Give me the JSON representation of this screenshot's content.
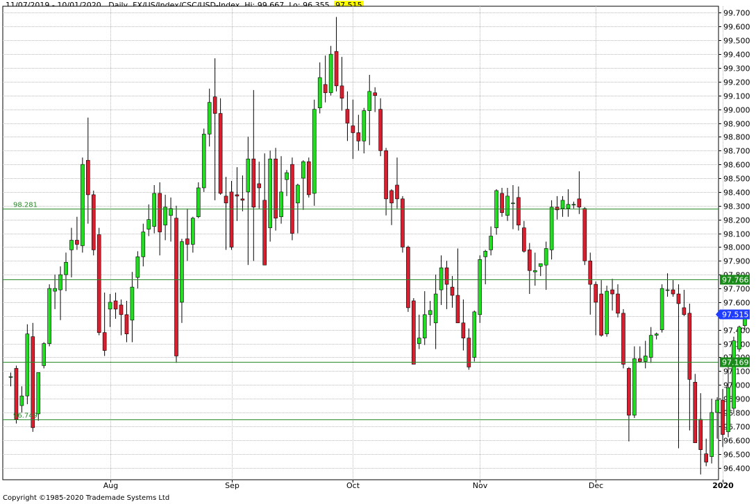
{
  "header": {
    "date_range": "11/07/2019 - 10/01/2020",
    "interval": "Daily",
    "symbol": "FX/US/Index/CSC/USD-Index",
    "hi": "Hi: 99.667",
    "lo": "Lo: 96.355",
    "last": "97.515"
  },
  "footer": {
    "copyright": "Copyright ©1985-2020 Trademade Systems Ltd"
  },
  "colors": {
    "up": "#22dd22",
    "down": "#d81f2f",
    "hline": "#2a8a2a",
    "grid": "#b8b8b8",
    "last_marker": "#1f3cff",
    "level_marker": "#1a8a1a"
  },
  "chart_data": {
    "type": "candlestick",
    "ylim": [
      96.35,
      99.75
    ],
    "y_ticks": [
      "96.400",
      "96.500",
      "96.600",
      "96.700",
      "96.800",
      "96.900",
      "97.000",
      "97.100",
      "97.200",
      "97.300",
      "97.400",
      "97.500",
      "97.600",
      "97.700",
      "97.800",
      "97.900",
      "98.000",
      "98.100",
      "98.200",
      "98.300",
      "98.400",
      "98.500",
      "98.600",
      "98.700",
      "98.800",
      "98.900",
      "99.000",
      "99.100",
      "99.200",
      "99.300",
      "99.400",
      "99.500",
      "99.600",
      "99.700"
    ],
    "x_labels": [
      {
        "label": "Aug",
        "index": 18,
        "bold": false
      },
      {
        "label": "Sep",
        "index": 40,
        "bold": false
      },
      {
        "label": "Oct",
        "index": 62,
        "bold": false
      },
      {
        "label": "Nov",
        "index": 85,
        "bold": false
      },
      {
        "label": "Dec",
        "index": 106,
        "bold": false
      },
      {
        "label": "2020",
        "index": 129,
        "bold": true
      }
    ],
    "horizontal_lines": [
      {
        "value": 98.281,
        "label": "98.281",
        "label_side": "left"
      },
      {
        "value": 97.766,
        "label": "97.766",
        "label_side": "right"
      },
      {
        "value": 97.169,
        "label": "97.169",
        "label_side": "right"
      },
      {
        "value": 96.749,
        "label": "96.749",
        "label_side": "left"
      }
    ],
    "last_value": {
      "value": 97.515,
      "label": "97.515"
    },
    "candles": [
      {
        "o": 97.06,
        "h": 97.09,
        "l": 96.99,
        "c": 97.06
      },
      {
        "o": 97.12,
        "h": 97.14,
        "l": 96.72,
        "c": 96.75
      },
      {
        "o": 96.85,
        "h": 96.99,
        "l": 96.8,
        "c": 96.92
      },
      {
        "o": 96.92,
        "h": 97.44,
        "l": 96.86,
        "c": 97.37
      },
      {
        "o": 97.35,
        "h": 97.45,
        "l": 96.66,
        "c": 96.69
      },
      {
        "o": 96.79,
        "h": 96.97,
        "l": 96.74,
        "c": 97.09
      },
      {
        "o": 97.14,
        "h": 97.31,
        "l": 97.12,
        "c": 97.3
      },
      {
        "o": 97.3,
        "h": 97.73,
        "l": 97.28,
        "c": 97.7
      },
      {
        "o": 97.68,
        "h": 97.8,
        "l": 97.55,
        "c": 97.7
      },
      {
        "o": 97.69,
        "h": 97.86,
        "l": 97.47,
        "c": 97.8
      },
      {
        "o": 97.8,
        "h": 97.96,
        "l": 97.68,
        "c": 97.89
      },
      {
        "o": 97.98,
        "h": 98.14,
        "l": 97.78,
        "c": 98.05
      },
      {
        "o": 98.05,
        "h": 98.22,
        "l": 97.98,
        "c": 98.02
      },
      {
        "o": 98.01,
        "h": 98.65,
        "l": 97.96,
        "c": 98.6
      },
      {
        "o": 98.63,
        "h": 98.94,
        "l": 98.17,
        "c": 98.38
      },
      {
        "o": 98.38,
        "h": 98.41,
        "l": 97.94,
        "c": 97.98
      },
      {
        "o": 98.09,
        "h": 98.14,
        "l": 97.36,
        "c": 97.38
      },
      {
        "o": 97.38,
        "h": 97.67,
        "l": 97.21,
        "c": 97.25
      },
      {
        "o": 97.55,
        "h": 97.66,
        "l": 97.42,
        "c": 97.6
      },
      {
        "o": 97.61,
        "h": 97.67,
        "l": 97.48,
        "c": 97.55
      },
      {
        "o": 97.58,
        "h": 97.62,
        "l": 97.36,
        "c": 97.51
      },
      {
        "o": 97.51,
        "h": 97.61,
        "l": 97.31,
        "c": 97.37
      },
      {
        "o": 97.47,
        "h": 97.82,
        "l": 97.31,
        "c": 97.71
      },
      {
        "o": 97.78,
        "h": 97.97,
        "l": 97.7,
        "c": 97.93
      },
      {
        "o": 97.93,
        "h": 98.17,
        "l": 97.86,
        "c": 98.11
      },
      {
        "o": 98.13,
        "h": 98.31,
        "l": 98.08,
        "c": 98.2
      },
      {
        "o": 98.15,
        "h": 98.45,
        "l": 98.1,
        "c": 98.39
      },
      {
        "o": 98.39,
        "h": 98.47,
        "l": 97.94,
        "c": 98.11
      },
      {
        "o": 98.16,
        "h": 98.38,
        "l": 98.05,
        "c": 98.29
      },
      {
        "o": 98.23,
        "h": 98.36,
        "l": 98.04,
        "c": 98.28
      },
      {
        "o": 98.21,
        "h": 98.3,
        "l": 97.16,
        "c": 97.21
      },
      {
        "o": 97.6,
        "h": 98.06,
        "l": 97.45,
        "c": 98.04
      },
      {
        "o": 98.06,
        "h": 98.28,
        "l": 97.9,
        "c": 98.02
      },
      {
        "o": 98.02,
        "h": 98.22,
        "l": 97.96,
        "c": 98.21
      },
      {
        "o": 98.22,
        "h": 98.47,
        "l": 98.21,
        "c": 98.43
      },
      {
        "o": 98.43,
        "h": 98.86,
        "l": 98.4,
        "c": 98.82
      },
      {
        "o": 98.82,
        "h": 99.15,
        "l": 98.73,
        "c": 99.05
      },
      {
        "o": 99.09,
        "h": 99.37,
        "l": 98.34,
        "c": 98.97
      },
      {
        "o": 98.97,
        "h": 99.08,
        "l": 98.38,
        "c": 98.39
      },
      {
        "o": 98.37,
        "h": 98.51,
        "l": 97.98,
        "c": 98.32
      },
      {
        "o": 98.4,
        "h": 98.48,
        "l": 97.98,
        "c": 98.0
      },
      {
        "o": 98.38,
        "h": 98.58,
        "l": 98.19,
        "c": 98.37
      },
      {
        "o": 98.35,
        "h": 98.52,
        "l": 98.26,
        "c": 98.34
      },
      {
        "o": 98.4,
        "h": 98.8,
        "l": 97.87,
        "c": 98.64
      },
      {
        "o": 98.64,
        "h": 99.14,
        "l": 97.9,
        "c": 98.29
      },
      {
        "o": 98.46,
        "h": 98.62,
        "l": 98.28,
        "c": 98.43
      },
      {
        "o": 98.34,
        "h": 98.68,
        "l": 97.87,
        "c": 97.87
      },
      {
        "o": 98.14,
        "h": 98.7,
        "l": 98.04,
        "c": 98.64
      },
      {
        "o": 98.64,
        "h": 98.72,
        "l": 98.12,
        "c": 98.21
      },
      {
        "o": 98.22,
        "h": 98.66,
        "l": 98.17,
        "c": 98.4
      },
      {
        "o": 98.49,
        "h": 98.56,
        "l": 98.37,
        "c": 98.54
      },
      {
        "o": 98.6,
        "h": 98.65,
        "l": 98.05,
        "c": 98.1
      },
      {
        "o": 98.32,
        "h": 98.46,
        "l": 98.1,
        "c": 98.45
      },
      {
        "o": 98.5,
        "h": 98.63,
        "l": 98.27,
        "c": 98.62
      },
      {
        "o": 98.62,
        "h": 98.65,
        "l": 98.36,
        "c": 98.38
      },
      {
        "o": 98.39,
        "h": 99.07,
        "l": 98.3,
        "c": 99.0
      },
      {
        "o": 99.01,
        "h": 99.34,
        "l": 98.97,
        "c": 99.23
      },
      {
        "o": 99.18,
        "h": 99.39,
        "l": 99.05,
        "c": 99.12
      },
      {
        "o": 99.12,
        "h": 99.46,
        "l": 99.1,
        "c": 99.4
      },
      {
        "o": 99.42,
        "h": 99.67,
        "l": 99.13,
        "c": 99.17
      },
      {
        "o": 99.17,
        "h": 99.38,
        "l": 98.99,
        "c": 99.08
      },
      {
        "o": 99.0,
        "h": 99.13,
        "l": 98.77,
        "c": 98.9
      },
      {
        "o": 98.88,
        "h": 99.07,
        "l": 98.64,
        "c": 98.83
      },
      {
        "o": 98.83,
        "h": 98.96,
        "l": 98.7,
        "c": 98.77
      },
      {
        "o": 98.77,
        "h": 99.01,
        "l": 98.68,
        "c": 98.99
      },
      {
        "o": 98.99,
        "h": 99.25,
        "l": 98.74,
        "c": 99.13
      },
      {
        "o": 99.12,
        "h": 99.16,
        "l": 98.98,
        "c": 99.1
      },
      {
        "o": 99.0,
        "h": 99.08,
        "l": 98.66,
        "c": 98.7
      },
      {
        "o": 98.7,
        "h": 98.72,
        "l": 98.23,
        "c": 98.35
      },
      {
        "o": 98.41,
        "h": 98.42,
        "l": 98.16,
        "c": 98.32
      },
      {
        "o": 98.45,
        "h": 98.65,
        "l": 98.28,
        "c": 98.35
      },
      {
        "o": 98.35,
        "h": 98.37,
        "l": 97.96,
        "c": 98.0
      },
      {
        "o": 98.0,
        "h": 98.01,
        "l": 97.53,
        "c": 97.56
      },
      {
        "o": 97.61,
        "h": 97.63,
        "l": 97.16,
        "c": 97.15
      },
      {
        "o": 97.3,
        "h": 97.51,
        "l": 97.26,
        "c": 97.34
      },
      {
        "o": 97.34,
        "h": 97.68,
        "l": 97.29,
        "c": 97.51
      },
      {
        "o": 97.51,
        "h": 97.61,
        "l": 97.43,
        "c": 97.54
      },
      {
        "o": 97.45,
        "h": 97.8,
        "l": 97.26,
        "c": 97.66
      },
      {
        "o": 97.69,
        "h": 97.94,
        "l": 97.58,
        "c": 97.85
      },
      {
        "o": 97.85,
        "h": 97.9,
        "l": 97.55,
        "c": 97.73
      },
      {
        "o": 97.71,
        "h": 97.79,
        "l": 97.56,
        "c": 97.65
      },
      {
        "o": 97.65,
        "h": 97.99,
        "l": 97.52,
        "c": 97.45
      },
      {
        "o": 97.45,
        "h": 97.62,
        "l": 97.25,
        "c": 97.34
      },
      {
        "o": 97.34,
        "h": 97.41,
        "l": 97.11,
        "c": 97.13
      },
      {
        "o": 97.2,
        "h": 97.54,
        "l": 97.17,
        "c": 97.53
      },
      {
        "o": 97.51,
        "h": 97.94,
        "l": 97.45,
        "c": 97.91
      },
      {
        "o": 97.93,
        "h": 97.98,
        "l": 97.73,
        "c": 97.97
      },
      {
        "o": 97.98,
        "h": 98.15,
        "l": 97.94,
        "c": 98.08
      },
      {
        "o": 98.14,
        "h": 98.42,
        "l": 98.09,
        "c": 98.41
      },
      {
        "o": 98.39,
        "h": 98.43,
        "l": 98.22,
        "c": 98.25
      },
      {
        "o": 98.23,
        "h": 98.43,
        "l": 98.19,
        "c": 98.37
      },
      {
        "o": 98.32,
        "h": 98.45,
        "l": 98.13,
        "c": 98.32
      },
      {
        "o": 98.36,
        "h": 98.44,
        "l": 98.12,
        "c": 98.16
      },
      {
        "o": 98.14,
        "h": 98.19,
        "l": 97.96,
        "c": 97.97
      },
      {
        "o": 97.98,
        "h": 98.03,
        "l": 97.66,
        "c": 97.83
      },
      {
        "o": 97.82,
        "h": 97.96,
        "l": 97.72,
        "c": 97.83
      },
      {
        "o": 97.86,
        "h": 97.88,
        "l": 97.79,
        "c": 97.88
      },
      {
        "o": 97.87,
        "h": 98.04,
        "l": 97.69,
        "c": 97.99
      },
      {
        "o": 97.98,
        "h": 98.34,
        "l": 97.91,
        "c": 98.29
      },
      {
        "o": 98.29,
        "h": 98.37,
        "l": 98.2,
        "c": 98.27
      },
      {
        "o": 98.28,
        "h": 98.37,
        "l": 98.22,
        "c": 98.34
      },
      {
        "o": 98.28,
        "h": 98.42,
        "l": 98.22,
        "c": 98.31
      },
      {
        "o": 98.31,
        "h": 98.33,
        "l": 98.28,
        "c": 98.31
      },
      {
        "o": 98.35,
        "h": 98.55,
        "l": 98.24,
        "c": 98.29
      },
      {
        "o": 98.28,
        "h": 98.29,
        "l": 97.87,
        "c": 97.9
      },
      {
        "o": 97.9,
        "h": 97.96,
        "l": 97.51,
        "c": 97.73
      },
      {
        "o": 97.73,
        "h": 97.75,
        "l": 97.36,
        "c": 97.6
      },
      {
        "o": 97.66,
        "h": 97.76,
        "l": 97.35,
        "c": 97.36
      },
      {
        "o": 97.37,
        "h": 97.72,
        "l": 97.35,
        "c": 97.68
      },
      {
        "o": 97.69,
        "h": 97.77,
        "l": 97.54,
        "c": 97.66
      },
      {
        "o": 97.66,
        "h": 97.73,
        "l": 97.49,
        "c": 97.52
      },
      {
        "o": 97.52,
        "h": 97.55,
        "l": 97.12,
        "c": 97.15
      },
      {
        "o": 97.12,
        "h": 97.13,
        "l": 96.59,
        "c": 96.78
      },
      {
        "o": 96.78,
        "h": 97.28,
        "l": 96.76,
        "c": 97.19
      },
      {
        "o": 97.19,
        "h": 97.28,
        "l": 97.16,
        "c": 97.17
      },
      {
        "o": 97.17,
        "h": 97.32,
        "l": 97.12,
        "c": 97.21
      },
      {
        "o": 97.2,
        "h": 97.42,
        "l": 97.16,
        "c": 97.36
      },
      {
        "o": 97.36,
        "h": 97.38,
        "l": 97.33,
        "c": 97.37
      },
      {
        "o": 97.4,
        "h": 97.73,
        "l": 97.38,
        "c": 97.7
      },
      {
        "o": 97.69,
        "h": 97.81,
        "l": 97.64,
        "c": 97.69
      },
      {
        "o": 97.69,
        "h": 97.76,
        "l": 97.64,
        "c": 97.66
      },
      {
        "o": 97.66,
        "h": 97.73,
        "l": 96.54,
        "c": 97.59
      },
      {
        "o": 97.56,
        "h": 97.69,
        "l": 97.5,
        "c": 97.51
      },
      {
        "o": 97.52,
        "h": 97.59,
        "l": 96.67,
        "c": 97.04
      },
      {
        "o": 97.02,
        "h": 97.08,
        "l": 96.6,
        "c": 96.58
      },
      {
        "o": 96.75,
        "h": 96.94,
        "l": 96.35,
        "c": 96.53
      },
      {
        "o": 96.5,
        "h": 96.61,
        "l": 96.41,
        "c": 96.44
      },
      {
        "o": 96.48,
        "h": 96.9,
        "l": 96.43,
        "c": 96.8
      },
      {
        "o": 96.8,
        "h": 96.91,
        "l": 96.61,
        "c": 96.89
      },
      {
        "o": 96.89,
        "h": 96.97,
        "l": 96.55,
        "c": 96.64
      },
      {
        "o": 96.66,
        "h": 97.14,
        "l": 96.62,
        "c": 96.98
      },
      {
        "o": 96.83,
        "h": 97.35,
        "l": 96.79,
        "c": 97.32
      },
      {
        "o": 97.26,
        "h": 97.43,
        "l": 97.24,
        "c": 97.42
      },
      {
        "o": 97.43,
        "h": 97.52,
        "l": 97.4,
        "c": 97.52
      }
    ]
  }
}
